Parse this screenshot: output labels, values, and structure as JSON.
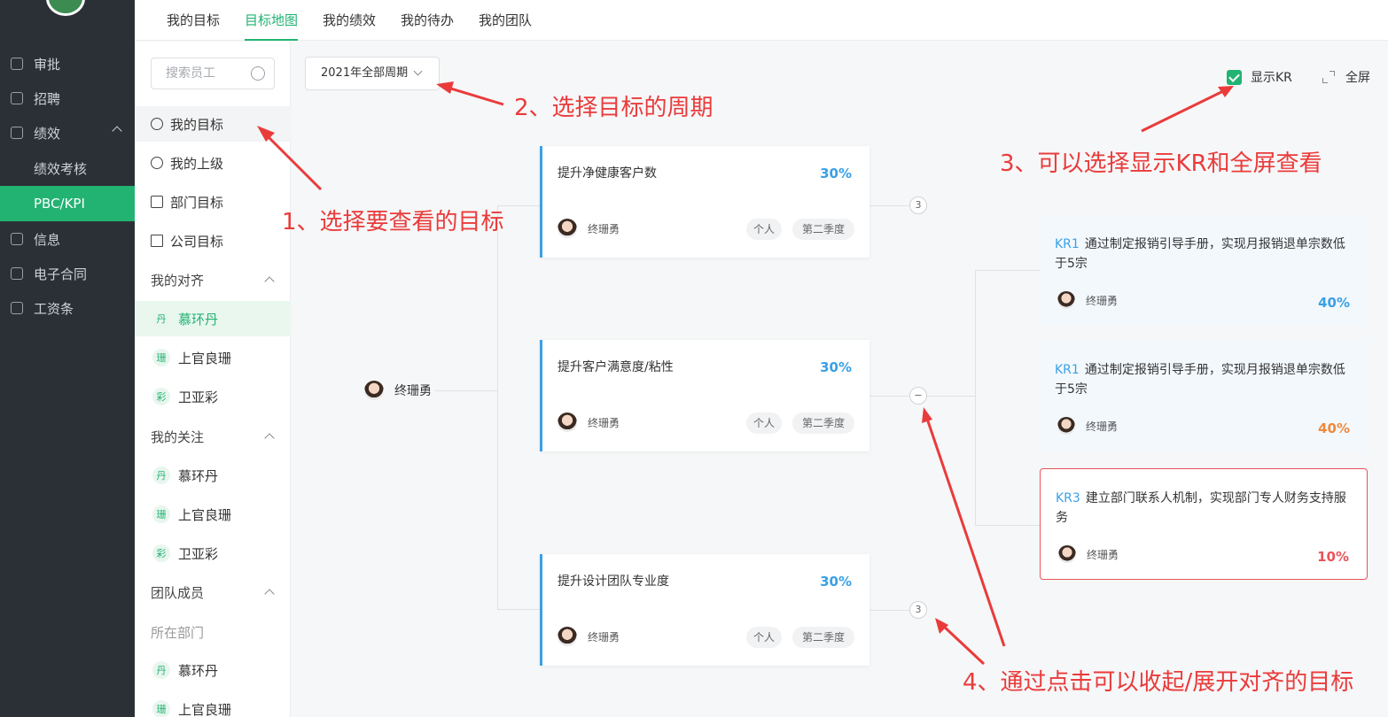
{
  "nav": {
    "items": [
      {
        "label": "审批",
        "icon": "approval-icon"
      },
      {
        "label": "招聘",
        "icon": "recruit-icon"
      },
      {
        "label": "绩效",
        "icon": "performance-icon"
      },
      {
        "label": "绩效考核"
      },
      {
        "label": "PBC/KPI"
      },
      {
        "label": "信息",
        "icon": "info-icon"
      },
      {
        "label": "电子合同",
        "icon": "contract-icon"
      },
      {
        "label": "工资条",
        "icon": "payslip-icon"
      }
    ]
  },
  "tabs": [
    "我的目标",
    "目标地图",
    "我的绩效",
    "我的待办",
    "我的团队"
  ],
  "side": {
    "search_placeholder": "搜索员工",
    "my_goal": "我的目标",
    "superior": "我的上级",
    "dept_goal": "部门目标",
    "company_goal": "公司目标",
    "alignment": "我的对齐",
    "alignment_people": [
      {
        "badge": "丹",
        "name": "慕环丹"
      },
      {
        "badge": "珊",
        "name": "上官良珊"
      },
      {
        "badge": "彩",
        "name": "卫亚彩"
      }
    ],
    "follow": "我的关注",
    "follow_people": [
      {
        "badge": "丹",
        "name": "慕环丹"
      },
      {
        "badge": "珊",
        "name": "上官良珊"
      },
      {
        "badge": "彩",
        "name": "卫亚彩"
      }
    ],
    "team": "团队成员",
    "dept": "所在部门",
    "team_people": [
      {
        "badge": "丹",
        "name": "慕环丹"
      },
      {
        "badge": "珊",
        "name": "上官良珊"
      }
    ]
  },
  "toolbar": {
    "period": "2021年全部周期",
    "show_kr": "显示KR",
    "fullscreen": "全屏"
  },
  "map": {
    "root_name": "终珊勇",
    "goals": [
      {
        "title": "提升净健康客户数",
        "pct": "30%",
        "owner": "终珊勇",
        "tag1": "个人",
        "tag2": "第二季度",
        "node": "3"
      },
      {
        "title": "提升客户满意度/粘性",
        "pct": "30%",
        "owner": "终珊勇",
        "tag1": "个人",
        "tag2": "第二季度",
        "node": "−"
      },
      {
        "title": "提升设计团队专业度",
        "pct": "30%",
        "owner": "终珊勇",
        "tag1": "个人",
        "tag2": "第二季度",
        "node": "3"
      }
    ],
    "krs": [
      {
        "id": "KR1",
        "text": "通过制定报销引导手册，实现月报销退单宗数低于5宗",
        "owner": "终珊勇",
        "pct": "40%",
        "color": "#3aa0e6"
      },
      {
        "id": "KR1",
        "text": "通过制定报销引导手册，实现月报销退单宗数低于5宗",
        "owner": "终珊勇",
        "pct": "40%",
        "color": "#f08a3c"
      },
      {
        "id": "KR3",
        "text": "建立部门联系人机制，实现部门专人财务支持服务",
        "owner": "终珊勇",
        "pct": "10%",
        "color": "#e8535a"
      }
    ]
  },
  "annotations": {
    "a1": "1、选择要查看的目标",
    "a2": "2、选择目标的周期",
    "a3": "3、可以选择显示KR和全屏查看",
    "a4": "4、通过点击可以收起/展开对齐的目标"
  },
  "colors": {
    "brand_green": "#22b372",
    "accent_blue": "#3aa0e6",
    "annotation_red": "#ea3b3b"
  }
}
